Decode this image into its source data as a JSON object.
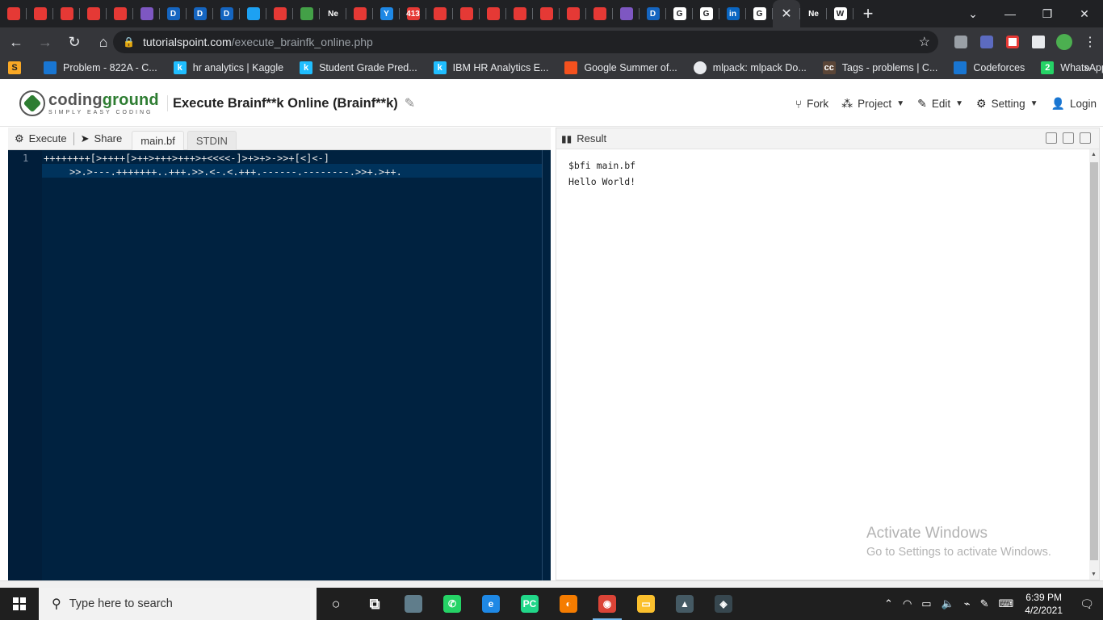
{
  "browser": {
    "tabs": [
      {
        "icon": "codeforces-icon",
        "color": "#e53935"
      },
      {
        "icon": "codeforces-icon",
        "color": "#e53935"
      },
      {
        "icon": "codeforces-icon",
        "color": "#e53935"
      },
      {
        "icon": "codeforces-icon",
        "color": "#e53935"
      },
      {
        "icon": "codeforces-icon",
        "color": "#e53935"
      },
      {
        "icon": "forms-icon",
        "color": "#7e57c2"
      },
      {
        "icon": "d-icon",
        "color": "#1565c0",
        "glyph": "D"
      },
      {
        "icon": "d-icon",
        "color": "#1565c0",
        "glyph": "D"
      },
      {
        "icon": "d-icon",
        "color": "#1565c0",
        "glyph": "D"
      },
      {
        "icon": "twitter-icon",
        "color": "#1da1f2"
      },
      {
        "icon": "v-icon",
        "color": "#e53935"
      },
      {
        "icon": "code-icon",
        "color": "#43a047"
      },
      {
        "icon": "ne-icon",
        "color": "#202124",
        "glyph": "Ne"
      },
      {
        "icon": "adobe-icon",
        "color": "#e53935"
      },
      {
        "icon": "y-icon",
        "color": "#1e88e5",
        "glyph": "Y"
      },
      {
        "icon": "calendar-icon",
        "color": "#e53935",
        "glyph": "413"
      },
      {
        "icon": "codeforces-icon",
        "color": "#e53935"
      },
      {
        "icon": "codeforces-icon",
        "color": "#e53935"
      },
      {
        "icon": "codeforces-icon",
        "color": "#e53935"
      },
      {
        "icon": "codeforces-icon",
        "color": "#e53935"
      },
      {
        "icon": "codeforces-icon",
        "color": "#e53935"
      },
      {
        "icon": "codeforces-icon",
        "color": "#e53935"
      },
      {
        "icon": "codeforces-icon",
        "color": "#e53935"
      },
      {
        "icon": "forms-icon",
        "color": "#7e57c2"
      },
      {
        "icon": "d-icon",
        "color": "#1565c0",
        "glyph": "D"
      },
      {
        "icon": "google-icon",
        "color": "#ffffff",
        "glyph": "G"
      },
      {
        "icon": "google-icon",
        "color": "#ffffff",
        "glyph": "G"
      },
      {
        "icon": "linkedin-icon",
        "color": "#0a66c2",
        "glyph": "in"
      },
      {
        "icon": "google-icon",
        "color": "#ffffff",
        "glyph": "G"
      },
      {
        "icon": "close-icon",
        "color": "#35363a",
        "glyph": "✕",
        "active": true
      },
      {
        "icon": "ne-icon",
        "color": "#202124",
        "glyph": "Ne"
      },
      {
        "icon": "wikipedia-icon",
        "color": "#ffffff",
        "glyph": "W"
      }
    ],
    "url_domain": "tutorialspoint.com",
    "url_path": "/execute_brainfk_online.php",
    "bookmarks": [
      {
        "label": "Problem - 822A - C...",
        "icon": "bar-chart-icon",
        "color": "#1976d2"
      },
      {
        "label": "hr analytics | Kaggle",
        "icon": "kaggle-icon",
        "color": "#20beff",
        "glyph": "k"
      },
      {
        "label": "Student Grade Pred...",
        "icon": "kaggle-icon",
        "color": "#20beff",
        "glyph": "k"
      },
      {
        "label": "IBM HR Analytics E...",
        "icon": "kaggle-icon",
        "color": "#20beff",
        "glyph": "k"
      },
      {
        "label": "Google Summer of...",
        "icon": "gsoc-icon",
        "color": "#f4511e"
      },
      {
        "label": "mlpack: mlpack Do...",
        "icon": "globe-icon",
        "color": "#e8eaed"
      },
      {
        "label": "Tags - problems | C...",
        "icon": "cc-icon",
        "color": "#5b4638",
        "glyph": "cc"
      },
      {
        "label": "Codeforces",
        "icon": "bar-chart-icon",
        "color": "#1976d2"
      },
      {
        "label": "WhatsApp",
        "icon": "whatsapp-icon",
        "color": "#25d366",
        "glyph": "2"
      }
    ]
  },
  "header": {
    "logo_word_1": "coding",
    "logo_word_2": "ground",
    "logo_tagline": "SIMPLY EASY CODING",
    "title": "Execute Brainf**k Online (Brainf**k)",
    "menu": [
      {
        "label": "Fork",
        "icon": "fork-icon",
        "glyph": "⑂"
      },
      {
        "label": "Project",
        "icon": "project-icon",
        "glyph": "⁂",
        "caret": true
      },
      {
        "label": "Edit",
        "icon": "edit-icon",
        "glyph": "✎",
        "caret": true
      },
      {
        "label": "Setting",
        "icon": "gear-icon",
        "glyph": "⚙",
        "caret": true
      },
      {
        "label": "Login",
        "icon": "user-icon",
        "glyph": "👤"
      }
    ]
  },
  "editor": {
    "execute_label": "Execute",
    "share_label": "Share",
    "tabs": [
      "main.bf",
      "STDIN"
    ],
    "line_number": "1",
    "code_line_1": "++++++++[>++++[>++>+++>+++>+<<<<-]>+>+>->>+[<]<-]",
    "code_line_2": ">>.>---.+++++++..+++.>>.<-.<.+++.------.--------.>>+.>++."
  },
  "result": {
    "header": "Result",
    "output_line_1": "$bfi main.bf",
    "output_line_2": "Hello World!"
  },
  "watermark": {
    "line_1": "Activate Windows",
    "line_2": "Go to Settings to activate Windows."
  },
  "taskbar": {
    "search_placeholder": "Type here to search",
    "apps": [
      {
        "icon": "cortana-icon",
        "color": "transparent",
        "glyph": "○"
      },
      {
        "icon": "task-view-icon",
        "color": "transparent",
        "glyph": "⧉"
      },
      {
        "icon": "tablet-icon",
        "color": "#607d8b",
        "glyph": ""
      },
      {
        "icon": "whatsapp-icon",
        "color": "#25d366",
        "glyph": "✆"
      },
      {
        "icon": "edge-icon",
        "color": "#1e88e5",
        "glyph": "e"
      },
      {
        "icon": "pycharm-icon",
        "color": "#21d789",
        "glyph": "PC"
      },
      {
        "icon": "eclipse-icon",
        "color": "#f57c00",
        "glyph": "◐"
      },
      {
        "icon": "chrome-icon",
        "color": "#db4437",
        "glyph": "◉",
        "active": true
      },
      {
        "icon": "folder-icon",
        "color": "#fbc02d",
        "glyph": "▭"
      },
      {
        "icon": "photos-icon",
        "color": "#455a64",
        "glyph": "▲"
      },
      {
        "icon": "steam-icon",
        "color": "#37474f",
        "glyph": "◈"
      }
    ],
    "time": "6:39 PM",
    "date": "4/2/2021"
  }
}
